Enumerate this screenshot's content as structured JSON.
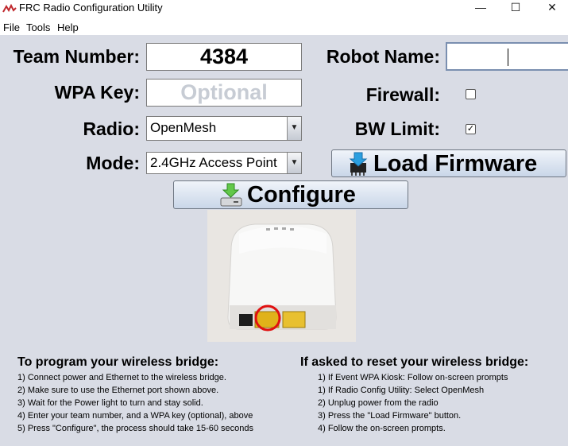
{
  "window": {
    "title": "FRC Radio Configuration Utility",
    "controls": {
      "minimize": "—",
      "maximize": "☐",
      "close": "✕"
    }
  },
  "menu": [
    "File",
    "Tools",
    "Help"
  ],
  "form": {
    "team_number_label": "Team Number:",
    "team_number_value": "4384",
    "robot_name_label": "Robot Name:",
    "robot_name_value": "",
    "wpa_key_label": "WPA Key:",
    "wpa_key_placeholder": "Optional",
    "firewall_label": "Firewall:",
    "firewall_checked": false,
    "radio_label": "Radio:",
    "radio_value": "OpenMesh",
    "bw_limit_label": "BW Limit:",
    "bw_limit_checked": true,
    "bw_limit_mark": "✓",
    "mode_label": "Mode:",
    "mode_value": "2.4GHz Access Point",
    "load_firmware_label": "Load Firmware",
    "configure_label": "Configure"
  },
  "instructions": {
    "program": {
      "heading": "To program your wireless bridge:",
      "steps": [
        "1) Connect power and Ethernet to the wireless bridge.",
        "2) Make sure to use the Ethernet port shown above.",
        "3) Wait for the Power light to turn and stay solid.",
        "4) Enter your team number, and a WPA key (optional), above",
        "5) Press \"Configure\", the process should take 15-60 seconds"
      ]
    },
    "reset": {
      "heading": "If asked to reset your wireless bridge:",
      "steps": [
        "1) If Event WPA Kiosk: Follow on-screen prompts",
        "1) If Radio Config Utility: Select OpenMesh",
        "2) Unplug power from the radio",
        "3) Press the \"Load Firmware\" button.",
        "4) Follow the on-screen prompts."
      ]
    }
  },
  "colors": {
    "background": "#d9dce5",
    "highlight_circle": "#e01010",
    "port_yellow": "#e6b800"
  }
}
